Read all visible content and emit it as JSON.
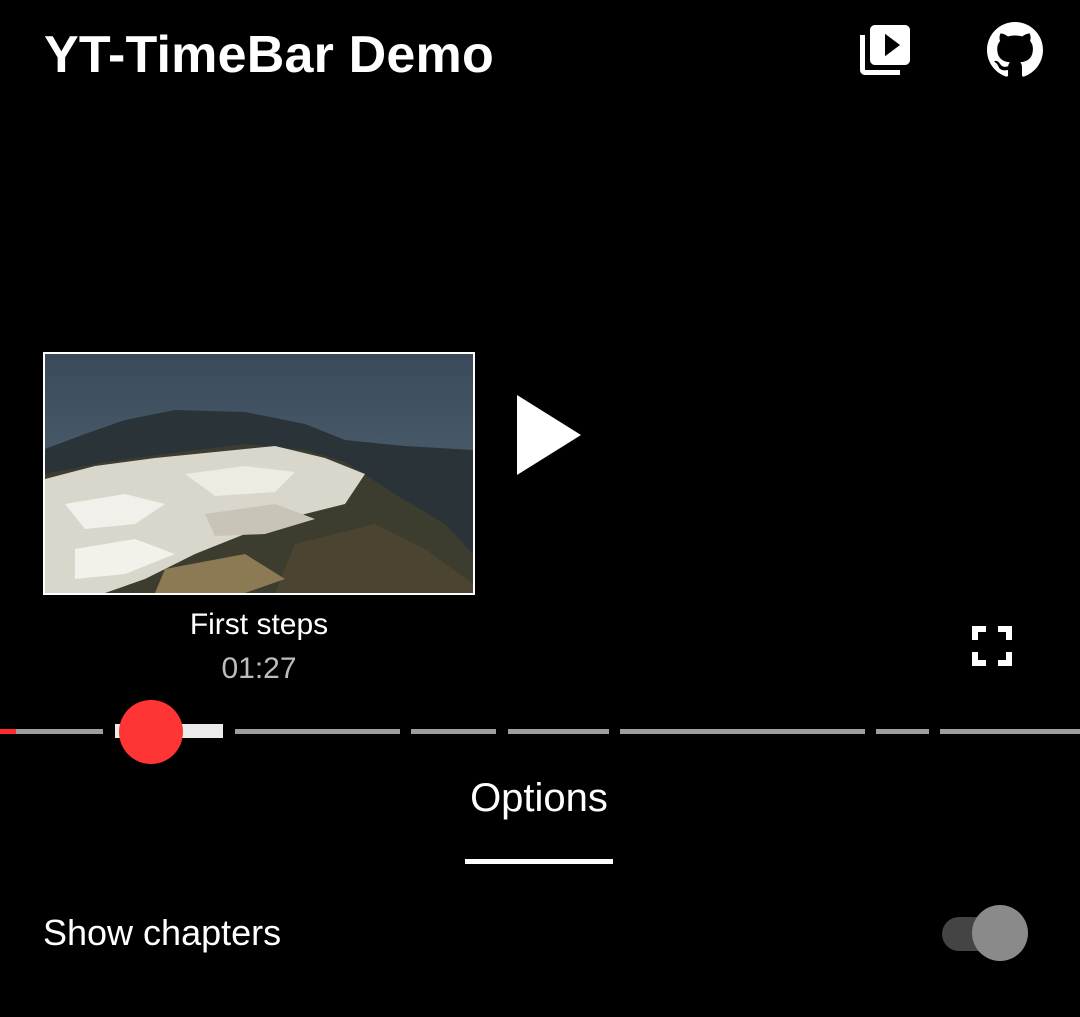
{
  "header": {
    "title": "YT-TimeBar Demo",
    "playlist_icon": "video-library-icon",
    "github_icon": "github-icon"
  },
  "player": {
    "play_icon": "play-icon",
    "fullscreen_icon": "fullscreen-icon",
    "preview": {
      "chapter_title": "First steps",
      "time": "01:27"
    },
    "timebar": {
      "played_color": "#ff2b2b",
      "segment_color": "#9e9e9e",
      "scrubber_color": "#ff3434"
    }
  },
  "tabs": [
    {
      "label": "Options",
      "selected": true
    }
  ],
  "options": {
    "show_chapters": {
      "label": "Show chapters",
      "enabled": false
    }
  }
}
